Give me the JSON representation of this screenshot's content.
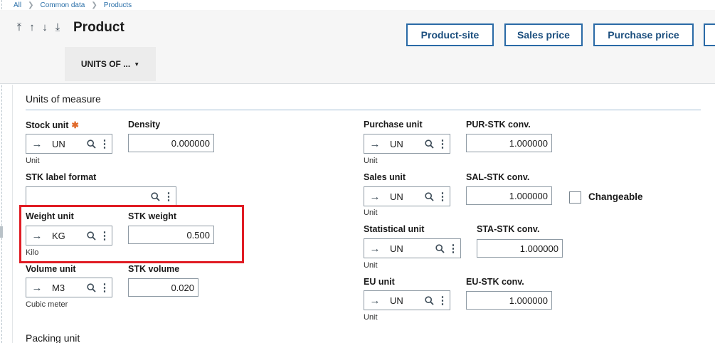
{
  "breadcrumb": [
    "All",
    "Common data",
    "Products"
  ],
  "header": {
    "title": "Product",
    "buttons": {
      "product_site": "Product-site",
      "sales_price": "Sales price",
      "purchase_price": "Purchase price"
    },
    "tab": "UNITS OF ..."
  },
  "section": {
    "title": "Units of measure",
    "next_title": "Packing unit"
  },
  "left": {
    "stock_unit": {
      "label": "Stock unit",
      "value": "UN",
      "desc": "Unit"
    },
    "density": {
      "label": "Density",
      "value": "0.000000"
    },
    "stk_label_format": {
      "label": "STK label format",
      "value": ""
    },
    "weight_unit": {
      "label": "Weight unit",
      "value": "KG",
      "desc": "Kilo"
    },
    "stk_weight": {
      "label": "STK weight",
      "value": "0.500"
    },
    "volume_unit": {
      "label": "Volume unit",
      "value": "M3",
      "desc": "Cubic meter"
    },
    "stk_volume": {
      "label": "STK volume",
      "value": "0.020"
    }
  },
  "right": {
    "purchase_unit": {
      "label": "Purchase unit",
      "value": "UN",
      "desc": "Unit"
    },
    "pur_stk_conv": {
      "label": "PUR-STK conv.",
      "value": "1.000000"
    },
    "sales_unit": {
      "label": "Sales unit",
      "value": "UN",
      "desc": "Unit"
    },
    "sal_stk_conv": {
      "label": "SAL-STK conv.",
      "value": "1.000000"
    },
    "changeable": {
      "label": "Changeable",
      "checked": false
    },
    "statistical_unit": {
      "label": "Statistical unit",
      "value": "UN",
      "desc": "Unit"
    },
    "sta_stk_conv": {
      "label": "STA-STK conv.",
      "value": "1.000000"
    },
    "eu_unit": {
      "label": "EU unit",
      "value": "UN",
      "desc": "Unit"
    },
    "eu_stk_conv": {
      "label": "EU-STK conv.",
      "value": "1.000000"
    }
  },
  "icons": {
    "arrow": "arrow-right-icon",
    "search": "search-icon",
    "more": "more-vertical-icon"
  },
  "colors": {
    "accent": "#2a6aa6",
    "highlight": "#e01c24",
    "required": "#e06a2c"
  }
}
